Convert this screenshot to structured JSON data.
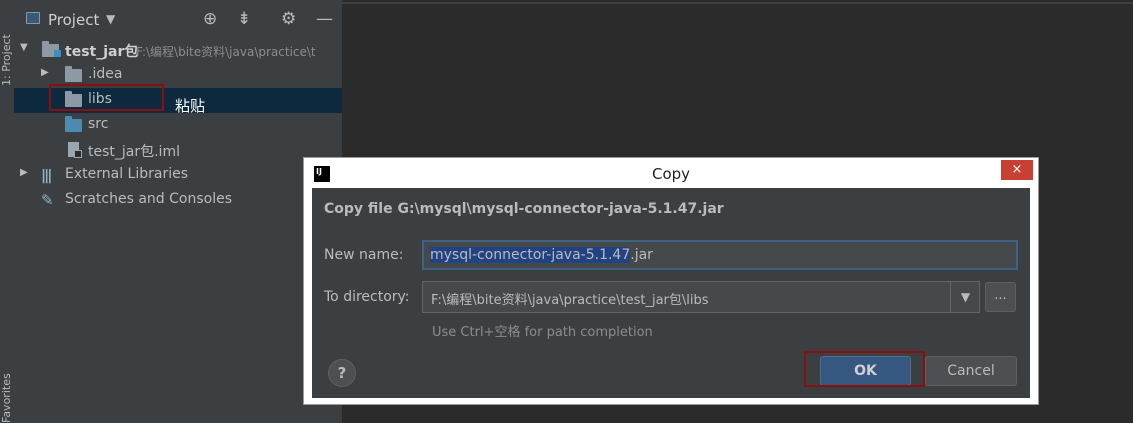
{
  "side_tabs": {
    "project": "1: Project",
    "favorites": "Favorites"
  },
  "project_panel": {
    "title": "Project",
    "header_icons": [
      "locate-icon",
      "collapse-icon",
      "gear-icon",
      "minimize-icon"
    ],
    "tree": [
      {
        "label": "test_jar包",
        "path": "F:\\编程\\bite资料\\java\\practice\\t"
      },
      {
        "label": ".idea"
      },
      {
        "label": "libs"
      },
      {
        "label": "src"
      },
      {
        "label": "test_jar包.iml"
      },
      {
        "label": "External Libraries"
      },
      {
        "label": "Scratches and Consoles"
      }
    ]
  },
  "annotation": {
    "paste": "粘贴"
  },
  "dialog": {
    "title": "Copy",
    "close": "×",
    "heading": "Copy file G:\\mysql\\mysql-connector-java-5.1.47.jar",
    "new_name_label": "New name:",
    "new_name_selected": "mysql-connector-java-5.1.47",
    "new_name_rest": ".jar",
    "directory_label": "To directory:",
    "directory_value": "F:\\编程\\bite资料\\java\\practice\\test_jar包\\libs",
    "browse": "...",
    "hint": "Use Ctrl+空格 for path completion",
    "help": "?",
    "ok": "OK",
    "cancel": "Cancel"
  },
  "colors": {
    "accent_selection": "#214283",
    "ok_button": "#365880",
    "annotation_red": "#8b0f0f",
    "close_button": "#c84031"
  }
}
